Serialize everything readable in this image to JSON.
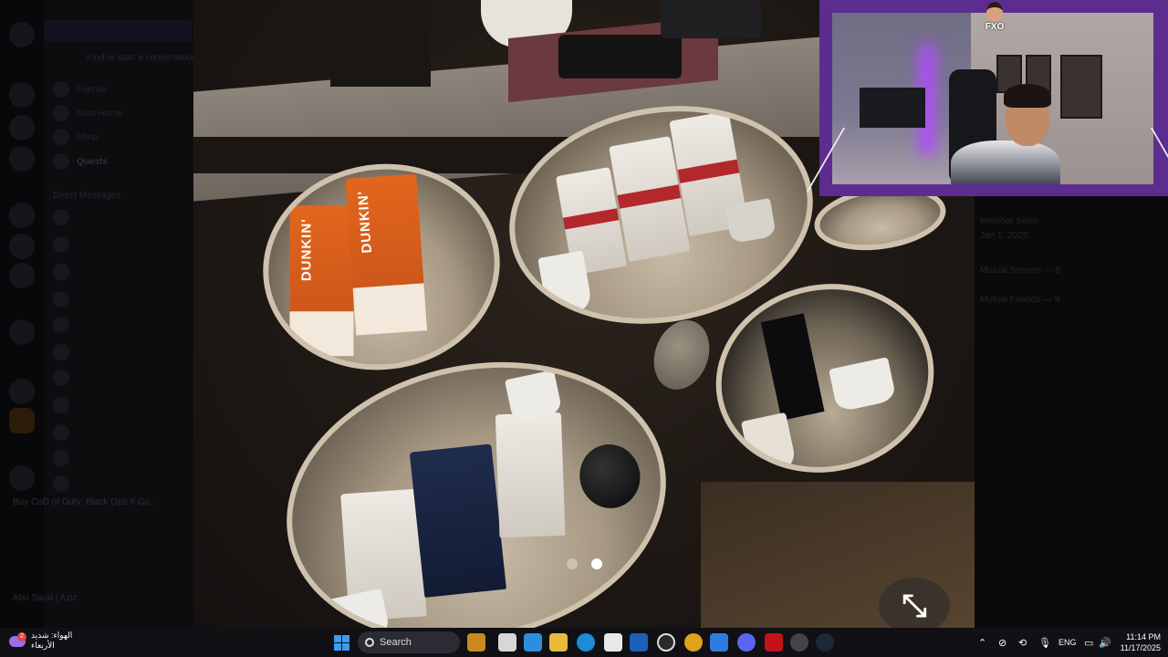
{
  "discord_background": {
    "find_placeholder": "Find or start a conversation",
    "nav_items": [
      "Friends",
      "Nitro Home",
      "Shop",
      "Quests"
    ],
    "direct_messages_header": "Direct Messages",
    "activity_text": "Buy CoD of Duty: Black Ops 6 Go...",
    "user_name": "Abu Saud | Aziz",
    "member_since_label": "Member Since",
    "member_since_value": "Jan 1, 2025",
    "mutual_servers": "Mutual Servers — 8",
    "mutual_friends": "Mutual Friends — 9"
  },
  "viewer": {
    "carousel_total": 2,
    "carousel_active": 2,
    "collapse_symbol": "⤡"
  },
  "webcam": {
    "logo_text": "FXO"
  },
  "taskbar": {
    "weather_line1": "الهواء: شديد",
    "weather_line2": "الأربعاء",
    "weather_badge": "2",
    "search_label": "Search",
    "language": "ENG",
    "time": "11:14 PM",
    "date": "11/17/2025",
    "colors": {
      "start": "#3d9bf2",
      "background": "#101015"
    }
  }
}
